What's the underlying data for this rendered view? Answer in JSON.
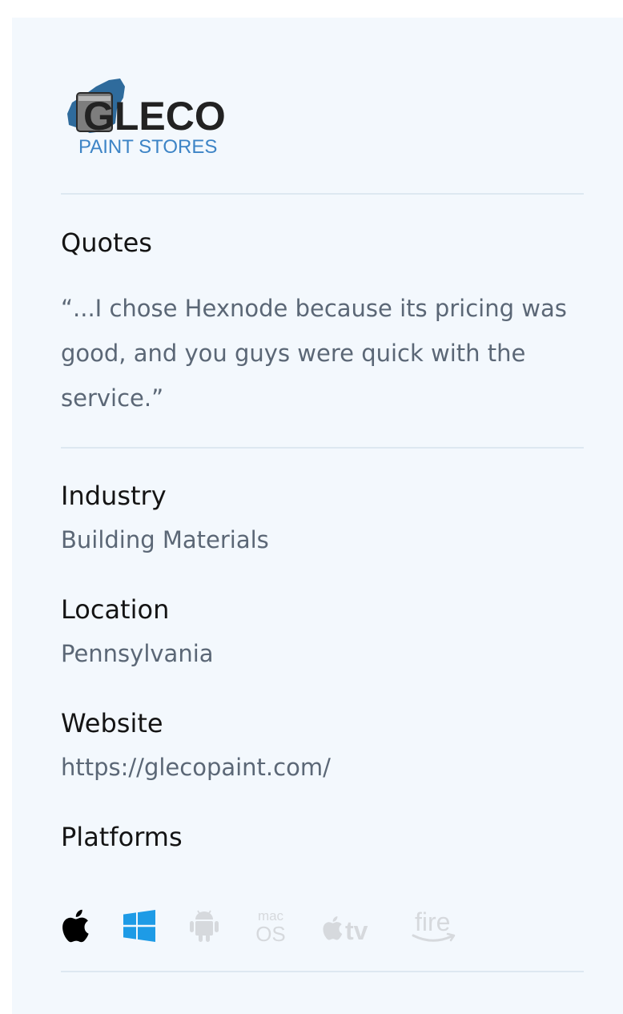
{
  "brand": {
    "name": "GLECO",
    "tagline": "PAINT STORES",
    "colors": {
      "dark": "#222222",
      "blue": "#3d84c6",
      "splash": "#2f6b9c"
    }
  },
  "quotes": {
    "heading": "Quotes",
    "text": "“...I chose Hexnode because its pricing was good, and you guys were quick with the service.”"
  },
  "industry": {
    "heading": "Industry",
    "value": "Building Materials"
  },
  "location": {
    "heading": "Location",
    "value": "Pennsylvania"
  },
  "website": {
    "heading": "Website",
    "value": "https://glecopaint.com/"
  },
  "platforms": {
    "heading": "Platforms",
    "items": [
      {
        "icon": "apple-icon",
        "active": true,
        "color": "#000000"
      },
      {
        "icon": "windows-icon",
        "active": true,
        "color": "#1e9be6"
      },
      {
        "icon": "android-icon",
        "active": false,
        "color": "#d6d9dd"
      },
      {
        "icon": "macos-icon",
        "active": false,
        "color": "#d6d9dd",
        "text_top": "mac",
        "text_bottom": "OS"
      },
      {
        "icon": "apple-tv-icon",
        "active": false,
        "color": "#d6d9dd",
        "text": "tv"
      },
      {
        "icon": "fire-tv-icon",
        "active": false,
        "color": "#d6d9dd",
        "text": "fire"
      }
    ]
  }
}
